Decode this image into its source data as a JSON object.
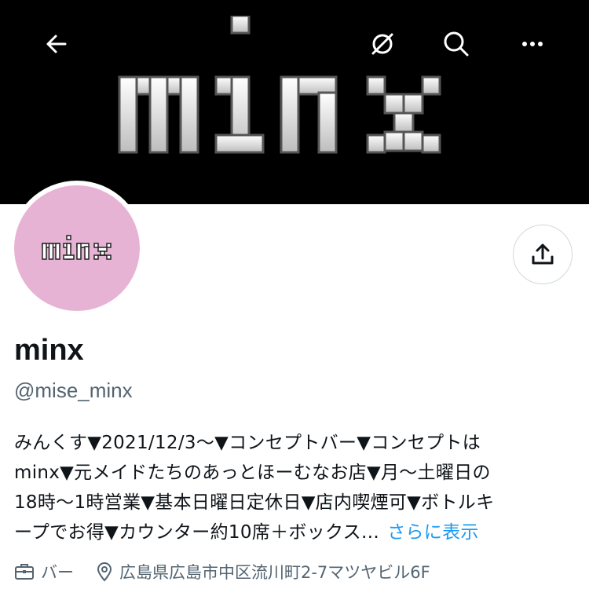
{
  "banner": {
    "logo_text": "minx"
  },
  "nav": {
    "back_icon": "arrow-left-icon",
    "grok_icon": "grok-icon",
    "search_icon": "search-icon",
    "more_icon": "more-icon"
  },
  "avatar": {
    "logo_text": "minx",
    "bg_color": "#e7b3d4"
  },
  "actions": {
    "share_icon": "share-icon"
  },
  "profile": {
    "display_name": "minx",
    "handle": "@mise_minx",
    "bio_lines": [
      "みんくす▼2021/12/3～▼コンセプトバー▼コンセプトは",
      "minx▼元メイドたちのあっとほーむなお店▼月～土曜日の",
      "18時～1時営業▼基本日曜日定休日▼店内喫煙可▼ボトルキ",
      "ープでお得▼カウンター約10席＋ボックス…"
    ],
    "bio_more": "さらに表示",
    "category": "バー",
    "location": "広島県広島市中区流川町2-7マツヤビル6F"
  },
  "colors": {
    "link": "#1d9bf0",
    "secondary_text": "#536471"
  }
}
